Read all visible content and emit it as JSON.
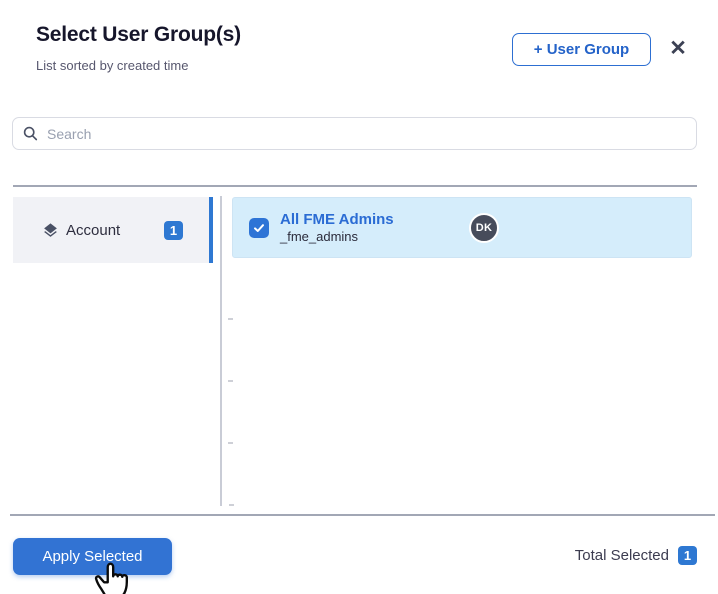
{
  "dialog": {
    "title": "Select User Group(s)",
    "subtitle": "List sorted by created time"
  },
  "header": {
    "add_group_button": "+ User Group"
  },
  "icons": {
    "close": "✕"
  },
  "search": {
    "placeholder": "Search",
    "value": ""
  },
  "sidebar": {
    "items": [
      {
        "label": "Account",
        "count": "1",
        "icon": "layers-icon",
        "active": true
      }
    ]
  },
  "groups": {
    "items": [
      {
        "name": "All FME Admins",
        "id": "_fme_admins",
        "avatar_initials": "DK",
        "checked": true
      }
    ]
  },
  "footer": {
    "apply_button": "Apply Selected",
    "total_label": "Total Selected",
    "total_count": "1"
  },
  "colors": {
    "accent_blue": "#2d6fd2",
    "badge_blue": "#2e78d2",
    "selected_row_bg": "#d5edfb",
    "apply_button_bg": "#3273d3",
    "sidebar_bg": "#f1f2f6"
  }
}
